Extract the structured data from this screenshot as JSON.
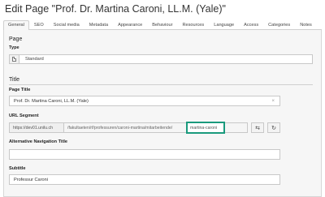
{
  "header": {
    "title": "Edit Page \"Prof. Dr. Martina Caroni, LL.M. (Yale)\""
  },
  "tabs": [
    "General",
    "SEO",
    "Social media",
    "Metadata",
    "Appearance",
    "Behaviour",
    "Resources",
    "Language",
    "Access",
    "Categories",
    "Notes"
  ],
  "active_tab": "General",
  "page_section": {
    "title": "Page",
    "type_label": "Type",
    "type_value": "Standard"
  },
  "title_section": {
    "title": "Title",
    "page_title_label": "Page Title",
    "page_title_value": "Prof. Dr. Martina Caroni, LL.M. (Yale)",
    "url_segment_label": "URL Segment",
    "url_prefix": "https://dev01.unilu.ch",
    "url_path": "/fakultaeten/rf/professuren/caroni-martina/mitarbeitende/",
    "url_slug": "martina-caroni",
    "alt_nav_label": "Alternative Navigation Title",
    "alt_nav_value": "",
    "subtitle_label": "Subtitle",
    "subtitle_value": "Professur Caroni"
  },
  "icons": {
    "clear": "×",
    "toggle": "⇆",
    "refresh": "↻"
  },
  "colors": {
    "highlight": "#1a9a7d"
  }
}
